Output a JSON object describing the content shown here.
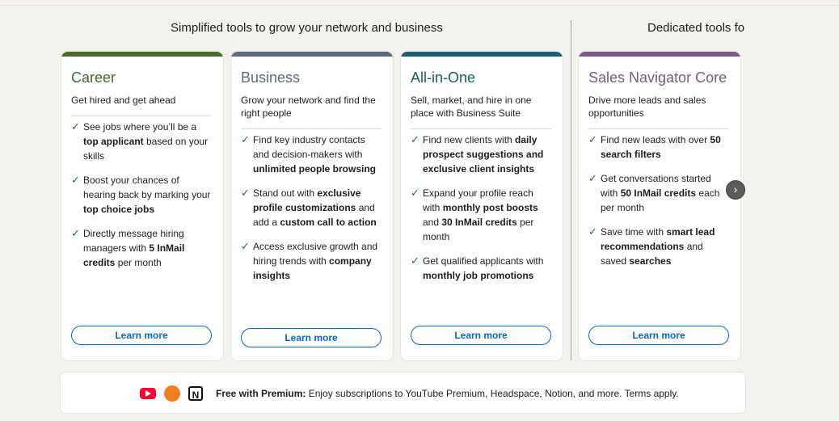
{
  "headings": {
    "left": "Simplified tools to grow your network and business",
    "right": "Dedicated tools fo"
  },
  "cards": [
    {
      "title": "Career",
      "color": "#44692a",
      "bar_color": "#4a6b2c",
      "subtitle": "Get hired and get ahead",
      "features": [
        [
          {
            "t": "See jobs where you’ll be a "
          },
          {
            "t": "top applicant",
            "b": true
          },
          {
            "t": " based on your skills"
          }
        ],
        [
          {
            "t": "Boost your chances of hearing back by marking your "
          },
          {
            "t": "top choice jobs",
            "b": true
          }
        ],
        [
          {
            "t": "Directly message hiring managers with "
          },
          {
            "t": "5 InMail credits",
            "b": true
          },
          {
            "t": " per month"
          }
        ]
      ],
      "button": "Learn more"
    },
    {
      "title": "Business",
      "color": "#5a6b7c",
      "bar_color": "#5e6b7a",
      "subtitle": "Grow your network and find the right people",
      "features": [
        [
          {
            "t": "Find key industry contacts and decision-makers with "
          },
          {
            "t": "unlimited people browsing",
            "b": true
          }
        ],
        [
          {
            "t": "Stand out with "
          },
          {
            "t": "exclusive profile customizations",
            "b": true
          },
          {
            "t": " and add a "
          },
          {
            "t": "custom call to action",
            "b": true
          }
        ],
        [
          {
            "t": "Access exclusive growth and hiring trends with "
          },
          {
            "t": "company insights",
            "b": true
          }
        ]
      ],
      "button": "Learn more"
    },
    {
      "title": "All-in-One",
      "color": "#1a5a6e",
      "bar_color": "#1f5e6e",
      "subtitle": "Sell, market, and hire in one place with Business Suite",
      "features": [
        [
          {
            "t": "Find new clients with "
          },
          {
            "t": "daily prospect suggestions and exclusive client insights",
            "b": true
          }
        ],
        [
          {
            "t": "Expand your profile reach with "
          },
          {
            "t": "monthly post boosts",
            "b": true
          },
          {
            "t": "  and  "
          },
          {
            "t": "30 InMail credits",
            "b": true
          },
          {
            "t": " per month"
          }
        ],
        [
          {
            "t": "Get qualified applicants with "
          },
          {
            "t": "monthly job promotions",
            "b": true
          }
        ]
      ],
      "button": "Learn more"
    },
    {
      "title": "Sales Navigator Core",
      "color": "#7a5a82",
      "bar_color": "#7d5a86",
      "subtitle": "Drive more leads and sales opportunities",
      "features": [
        [
          {
            "t": "Find new leads with over "
          },
          {
            "t": "50 search filters",
            "b": true
          }
        ],
        [
          {
            "t": "Get conversations started with "
          },
          {
            "t": "50 InMail credits",
            "b": true
          },
          {
            "t": " each per month"
          }
        ],
        [
          {
            "t": "Save time with "
          },
          {
            "t": "smart lead recommendations",
            "b": true
          },
          {
            "t": " and saved "
          },
          {
            "t": "searches",
            "b": true
          }
        ]
      ],
      "button": "Learn more"
    }
  ],
  "premium": {
    "label": "Free with Premium:",
    "text": " Enjoy subscriptions to YouTube Premium, Headspace, Notion, and more. Terms apply.",
    "icons": [
      "youtube-icon",
      "headspace-icon",
      "notion-icon"
    ]
  },
  "carousel": {
    "next_icon": "chevron-right-icon",
    "next_glyph": "›"
  }
}
